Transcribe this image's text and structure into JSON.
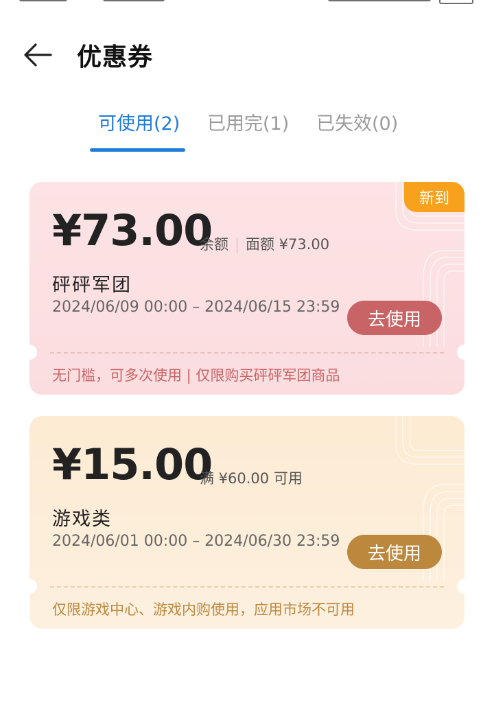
{
  "header": {
    "title": "优惠券"
  },
  "tabs": [
    {
      "label": "可使用(2)",
      "active": true
    },
    {
      "label": "已用完(1)",
      "active": false
    },
    {
      "label": "已失效(0)",
      "active": false
    }
  ],
  "coupons": [
    {
      "badge": "新到",
      "amount": "¥73.00",
      "balance_label": "余额",
      "face_value": "面额 ¥73.00",
      "name": "砰砰军团",
      "period": "2024/06/09 00:00 – 2024/06/15 23:59",
      "button": "去使用",
      "note": "无门槛，可多次使用 | 仅限购买砰砰军团商品"
    },
    {
      "amount": "¥15.00",
      "condition": "满 ¥60.00 可用",
      "name": "游戏类",
      "period": "2024/06/01 00:00 – 2024/06/30 23:59",
      "button": "去使用",
      "note": "仅限游戏中心、游戏内购使用，应用市场不可用"
    }
  ],
  "colors": {
    "accent": "#1e7bd8",
    "coupon1_bg": "#fde3e5",
    "coupon1_button": "#c86466",
    "coupon2_bg": "#fdebd3",
    "coupon2_button": "#bc883e",
    "badge": "#f7a11c"
  }
}
